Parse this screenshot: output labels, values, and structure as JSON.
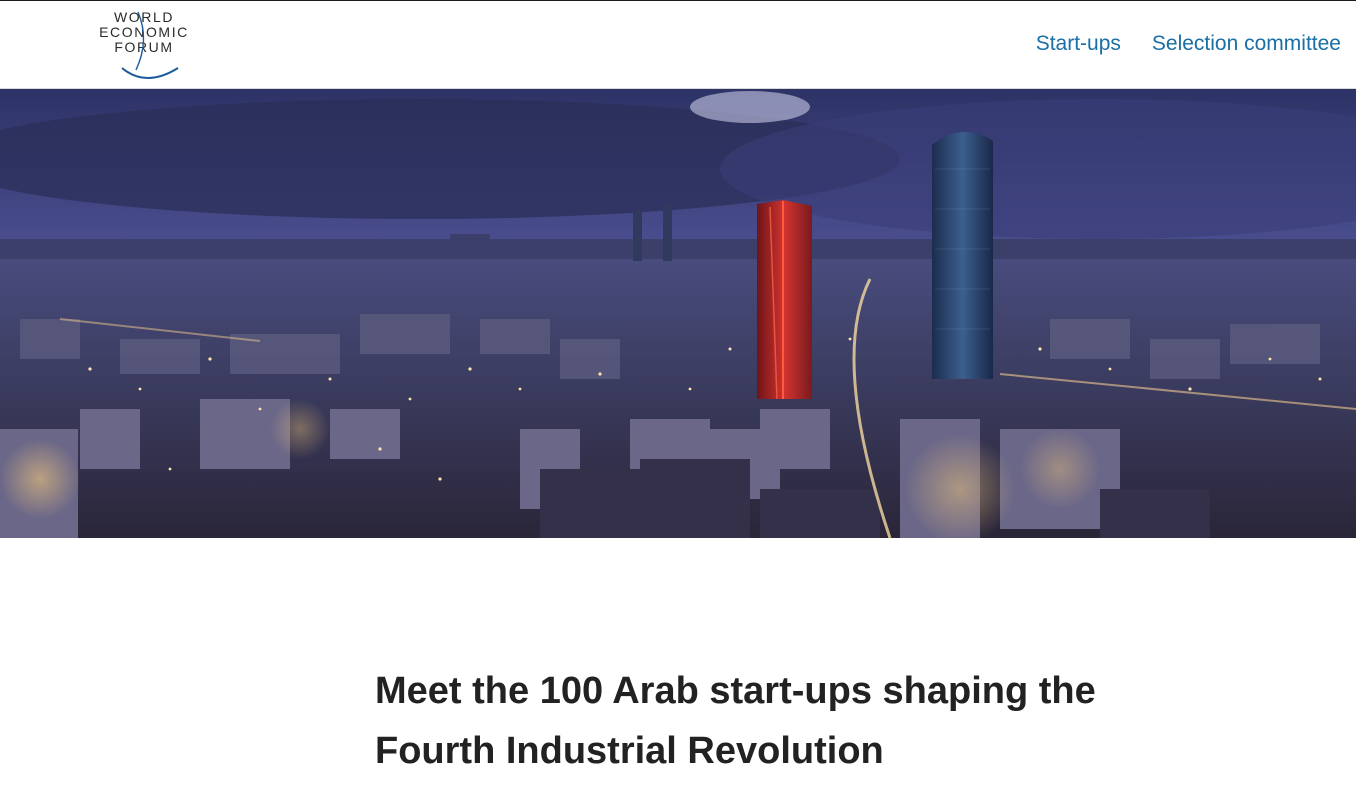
{
  "header": {
    "logo": {
      "line1": "WORLD",
      "line2": "ECONOMIC",
      "line3": "FORUM"
    },
    "nav": [
      {
        "label": "Start-ups"
      },
      {
        "label": "Selection committee"
      }
    ]
  },
  "hero": {
    "image": "city-skyline-night-photo"
  },
  "main": {
    "headline": "Meet the 100 Arab start-ups shaping the Fourth Industrial Revolution"
  },
  "colors": {
    "link": "#1a6fa5",
    "heading": "#222222",
    "sky": "#4a4e8f",
    "tower_red": "#b4232a"
  }
}
